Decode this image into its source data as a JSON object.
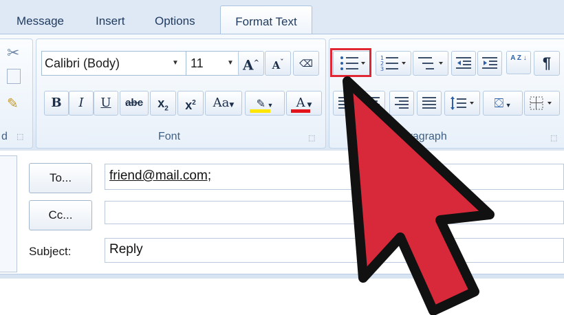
{
  "tabs": [
    {
      "label": "Message"
    },
    {
      "label": "Insert"
    },
    {
      "label": "Options"
    },
    {
      "label": "Format Text",
      "active": true
    }
  ],
  "font_group": {
    "label": "Font",
    "font_name": "Calibri (Body)",
    "font_size": "11",
    "bold": "B",
    "italic": "I",
    "underline": "U",
    "strikethrough": "abc",
    "subscript": "x",
    "superscript": "x",
    "change_case": "Aa",
    "grow_font": "A",
    "shrink_font": "A",
    "font_color": "A"
  },
  "paragraph_group": {
    "label": "Paragraph",
    "show_marks": "¶",
    "sort": "A Z"
  },
  "clipboard_group": {
    "label": "d"
  },
  "header_fields": {
    "to_button": "To...",
    "to_value": "friend@mail.com;",
    "cc_button": "Cc...",
    "cc_value": "",
    "subject_label": "Subject:",
    "subject_value": "Reply"
  },
  "colors": {
    "arrow_fill": "#d8293b",
    "highlight_box": "#e02632",
    "highlight_yellow": "#ffe600",
    "font_red": "#e3141c"
  }
}
